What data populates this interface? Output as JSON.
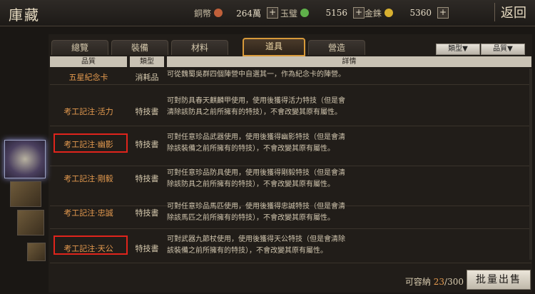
{
  "header": {
    "title": "庫藏",
    "back_label": "返回",
    "currencies": [
      {
        "label": "銅幣",
        "value": "264萬",
        "icon": "copper-coin-icon",
        "color": "#c0603a"
      },
      {
        "label": "玉璧",
        "value": "5156",
        "icon": "jade-icon",
        "color": "#5fb04a"
      },
      {
        "label": "金銖",
        "value": "5360",
        "icon": "gold-coin-icon",
        "color": "#d8b030"
      }
    ]
  },
  "tabs": [
    {
      "label": "總覽",
      "active": false
    },
    {
      "label": "裝備",
      "active": false
    },
    {
      "label": "材料",
      "active": false
    },
    {
      "label": "道具",
      "active": true
    },
    {
      "label": "營造",
      "active": false
    }
  ],
  "filters": [
    "類型▼",
    "品質▼"
  ],
  "columns": [
    "品質",
    "類型",
    "詳情"
  ],
  "rows": [
    {
      "name": "五星紀念卡",
      "type": "消耗品",
      "desc": [
        "可從魏蜀吳群四個陣營中自選其一，作為紀念卡的陣營。"
      ],
      "highlighted": false
    },
    {
      "name": "考工記注·活力",
      "type": "特技書",
      "desc": [
        "可對防具春天麒麟甲使用，使用後獲得活力特技（但是會",
        "清除該防具之前所擁有的特技），不會改變其原有屬性。"
      ],
      "highlighted": false
    },
    {
      "name": "考工記注·幽影",
      "type": "特技書",
      "desc": [
        "可對任意珍品武器使用，使用後獲得幽影特技（但是會清",
        "除該裝備之前所擁有的特技），不會改變其原有屬性。"
      ],
      "highlighted": true
    },
    {
      "name": "考工記注·剛毅",
      "type": "特技書",
      "desc": [
        "可對任意珍品防具使用，使用後獲得剛毅特技（但是會清",
        "除該防具之前所擁有的特技），不會改變其原有屬性。"
      ],
      "highlighted": false
    },
    {
      "name": "考工記注·忠誠",
      "type": "特技書",
      "desc": [
        "可對任意珍品馬匹使用，使用後獲得忠誠特技（但是會清",
        "除該馬匹之前所擁有的特技），不會改變其原有屬性。"
      ],
      "highlighted": false
    },
    {
      "name": "考工記注·天公",
      "type": "特技書",
      "desc": [
        "可對武器九節杖使用，使用後獲得天公特技（但是會清除",
        "該裝備之前所擁有的特技），不會改變其原有屬性。"
      ],
      "highlighted": true
    }
  ],
  "footer": {
    "capacity_label": "可容納",
    "capacity_used": "23",
    "capacity_total": "/300",
    "batch_sell_label": "批量出售"
  }
}
